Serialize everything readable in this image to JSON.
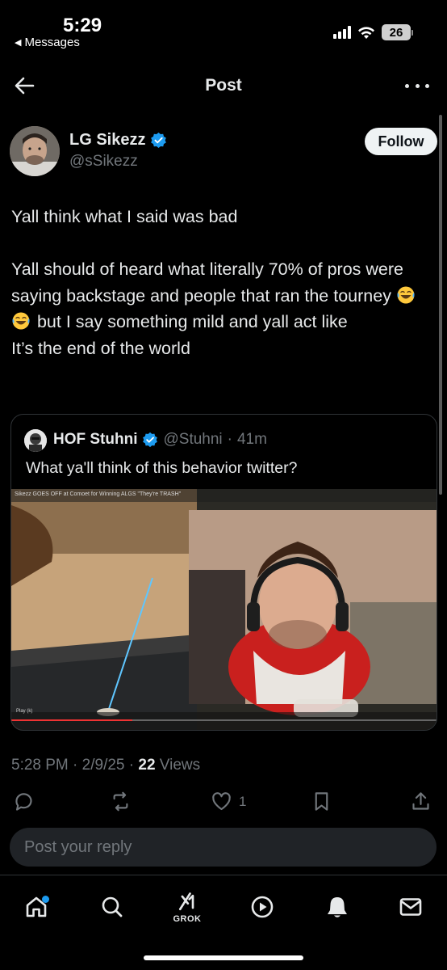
{
  "status_bar": {
    "time": "5:29",
    "back_app": "Messages",
    "battery": "26"
  },
  "header": {
    "title": "Post"
  },
  "author": {
    "name": "LG Sikezz",
    "handle": "@sSikezz",
    "verified": true,
    "follow_label": "Follow"
  },
  "post": {
    "line1": "Yall think what I said was bad",
    "line2a": "Yall should of heard what literally 70% of pros were saying backstage and people that ran the tourney",
    "line2b": " but I say something mild and yall act like",
    "line3": "It’s the end of the world",
    "emojis": [
      "face-with-tears-of-joy",
      "face-with-tears-of-joy"
    ]
  },
  "quoted_post": {
    "name": "HOF Stuhni",
    "handle": "@Stuhni",
    "time": "41m",
    "text": "What ya'll think of this behavior twitter?",
    "video_caption": "Sikezz GOES OFF at Comoet for Winning ALGS \"They're TRASH\"",
    "video_label": "Play (k)"
  },
  "meta": {
    "time": "5:28 PM",
    "date": "2/9/25",
    "views_count": "22",
    "views_label": "Views"
  },
  "actions": {
    "like_count": "1"
  },
  "reply": {
    "placeholder": "Post your reply"
  },
  "bottom_nav": {
    "grok_label": "GROK"
  },
  "colors": {
    "background": "#000000",
    "accent": "#1d9bf0",
    "muted": "#71767b",
    "text": "#e7e9ea"
  }
}
